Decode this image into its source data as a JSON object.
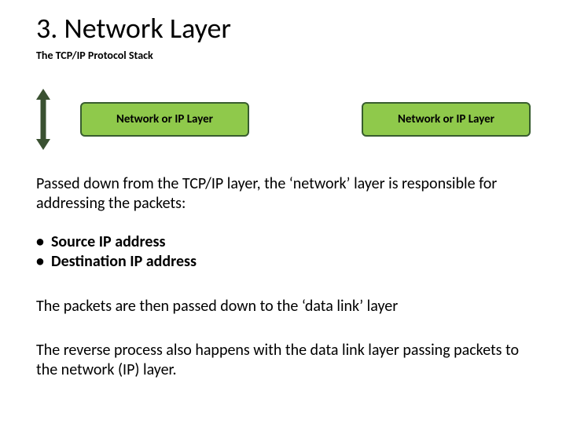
{
  "title": "3. Network Layer",
  "subtitle": "The TCP/IP Protocol Stack",
  "layer_left_label": "Network or IP Layer",
  "layer_right_label": "Network or IP Layer",
  "colors": {
    "box_fill": "#8fc94b",
    "box_border": "#385d2f",
    "arrow": "#3a5131"
  },
  "para1": "Passed down from the TCP/IP layer, the ‘network’ layer is responsible for addressing the packets:",
  "bullet1": "Source IP address",
  "bullet2": "Destination IP address",
  "para2": "The packets are then passed down to the ‘data link’ layer",
  "para3": "The reverse process also happens with the data link layer passing packets to the network (IP) layer."
}
